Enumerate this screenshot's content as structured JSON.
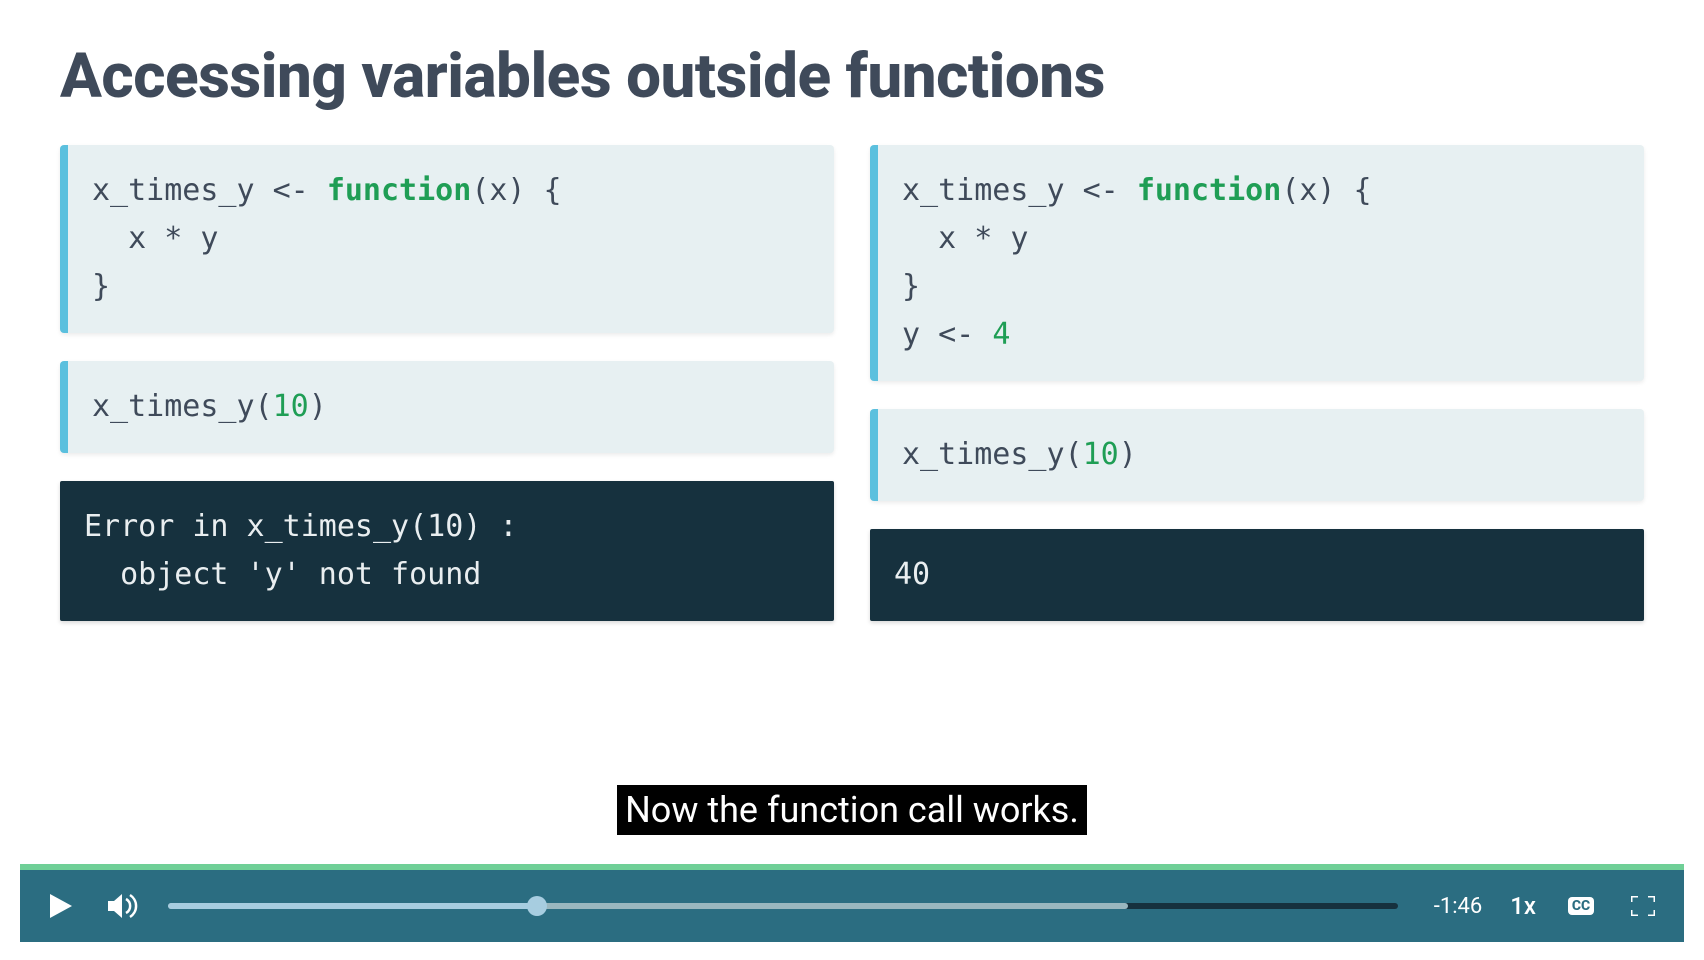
{
  "slide": {
    "title": "Accessing variables outside functions",
    "left": {
      "code1": {
        "l1a": "x_times_y <- ",
        "l1kw": "function",
        "l1b": "(x) {",
        "l2": "  x * y",
        "l3": "}"
      },
      "code2": {
        "l1a": "x_times_y(",
        "l1num": "10",
        "l1b": ")"
      },
      "output": "Error in x_times_y(10) :\n  object 'y' not found"
    },
    "right": {
      "code1": {
        "l1a": "x_times_y <- ",
        "l1kw": "function",
        "l1b": "(x) {",
        "l2": "  x * y",
        "l3": "}",
        "l4a": "y <- ",
        "l4num": "4"
      },
      "code2": {
        "l1a": "x_times_y(",
        "l1num": "10",
        "l1b": ")"
      },
      "output": "40"
    }
  },
  "caption": "Now the function call works.",
  "player": {
    "time_remaining": "-1:46",
    "speed": "1x",
    "cc": "CC",
    "progress_played_pct": 30,
    "progress_buffered_pct": 78
  },
  "colors": {
    "title": "#3f4a5a",
    "code_bg": "#e7f0f2",
    "code_accent": "#5bc0de",
    "keyword": "#1f9e55",
    "output_bg": "#16313e",
    "player_bg": "#2b6d81",
    "topbar": "#6fcf97"
  }
}
